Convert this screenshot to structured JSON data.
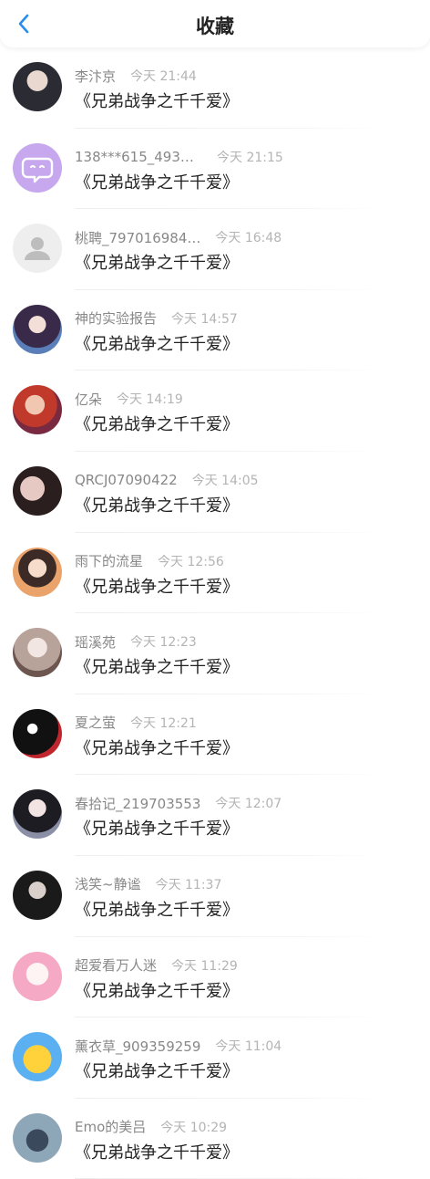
{
  "header": {
    "title": "收藏",
    "back_icon": "chevron-left-icon",
    "accent": "#2a8df0"
  },
  "items": [
    {
      "name": "李汴京",
      "time": "今天 21:44",
      "book": "《兄弟战争之千千爱》",
      "avatar": "photo"
    },
    {
      "name": "138***615_4932…",
      "time": "今天 21:15",
      "book": "《兄弟战争之千千爱》",
      "avatar": "purple-chat"
    },
    {
      "name": "桃聘_797016984…",
      "time": "今天 16:48",
      "book": "《兄弟战争之千千爱》",
      "avatar": "default-user"
    },
    {
      "name": "神的实验报告",
      "time": "今天 14:57",
      "book": "《兄弟战争之千千爱》",
      "avatar": "photo"
    },
    {
      "name": "亿朵",
      "time": "今天 14:19",
      "book": "《兄弟战争之千千爱》",
      "avatar": "photo"
    },
    {
      "name": "QRCJ07090422",
      "time": "今天 14:05",
      "book": "《兄弟战争之千千爱》",
      "avatar": "photo"
    },
    {
      "name": "雨下的流星",
      "time": "今天 12:56",
      "book": "《兄弟战争之千千爱》",
      "avatar": "photo"
    },
    {
      "name": "瑶溪苑",
      "time": "今天 12:23",
      "book": "《兄弟战争之千千爱》",
      "avatar": "photo"
    },
    {
      "name": "夏之萤",
      "time": "今天 12:21",
      "book": "《兄弟战争之千千爱》",
      "avatar": "photo"
    },
    {
      "name": "春拾记_219703553",
      "time": "今天 12:07",
      "book": "《兄弟战争之千千爱》",
      "avatar": "photo"
    },
    {
      "name": "浅笑~静谧",
      "time": "今天 11:37",
      "book": "《兄弟战争之千千爱》",
      "avatar": "photo"
    },
    {
      "name": "超爱看万人迷",
      "time": "今天 11:29",
      "book": "《兄弟战争之千千爱》",
      "avatar": "photo"
    },
    {
      "name": "薰衣草_909359259",
      "time": "今天 11:04",
      "book": "《兄弟战争之千千爱》",
      "avatar": "photo"
    },
    {
      "name": "Emo的美吕",
      "time": "今天 10:29",
      "book": "《兄弟战争之千千爱》",
      "avatar": "photo"
    }
  ]
}
